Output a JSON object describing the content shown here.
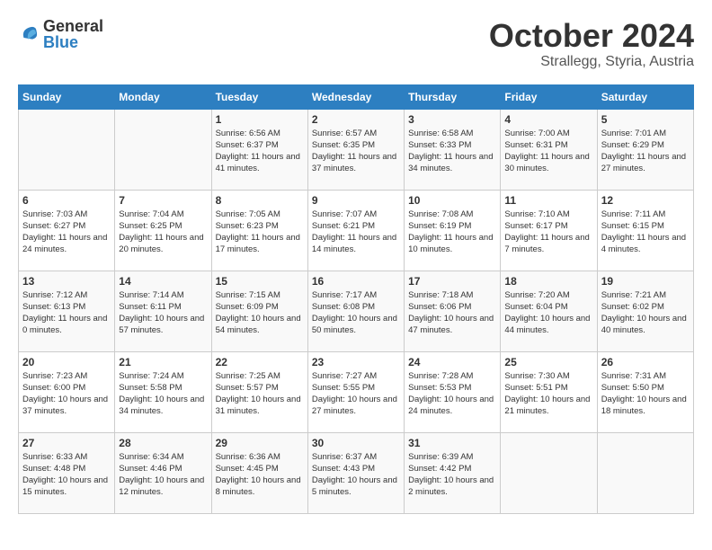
{
  "logo": {
    "line1": "General",
    "line2": "Blue"
  },
  "title": "October 2024",
  "subtitle": "Strallegg, Styria, Austria",
  "weekdays": [
    "Sunday",
    "Monday",
    "Tuesday",
    "Wednesday",
    "Thursday",
    "Friday",
    "Saturday"
  ],
  "weeks": [
    [
      {
        "day": "",
        "info": ""
      },
      {
        "day": "",
        "info": ""
      },
      {
        "day": "1",
        "info": "Sunrise: 6:56 AM\nSunset: 6:37 PM\nDaylight: 11 hours and 41 minutes."
      },
      {
        "day": "2",
        "info": "Sunrise: 6:57 AM\nSunset: 6:35 PM\nDaylight: 11 hours and 37 minutes."
      },
      {
        "day": "3",
        "info": "Sunrise: 6:58 AM\nSunset: 6:33 PM\nDaylight: 11 hours and 34 minutes."
      },
      {
        "day": "4",
        "info": "Sunrise: 7:00 AM\nSunset: 6:31 PM\nDaylight: 11 hours and 30 minutes."
      },
      {
        "day": "5",
        "info": "Sunrise: 7:01 AM\nSunset: 6:29 PM\nDaylight: 11 hours and 27 minutes."
      }
    ],
    [
      {
        "day": "6",
        "info": "Sunrise: 7:03 AM\nSunset: 6:27 PM\nDaylight: 11 hours and 24 minutes."
      },
      {
        "day": "7",
        "info": "Sunrise: 7:04 AM\nSunset: 6:25 PM\nDaylight: 11 hours and 20 minutes."
      },
      {
        "day": "8",
        "info": "Sunrise: 7:05 AM\nSunset: 6:23 PM\nDaylight: 11 hours and 17 minutes."
      },
      {
        "day": "9",
        "info": "Sunrise: 7:07 AM\nSunset: 6:21 PM\nDaylight: 11 hours and 14 minutes."
      },
      {
        "day": "10",
        "info": "Sunrise: 7:08 AM\nSunset: 6:19 PM\nDaylight: 11 hours and 10 minutes."
      },
      {
        "day": "11",
        "info": "Sunrise: 7:10 AM\nSunset: 6:17 PM\nDaylight: 11 hours and 7 minutes."
      },
      {
        "day": "12",
        "info": "Sunrise: 7:11 AM\nSunset: 6:15 PM\nDaylight: 11 hours and 4 minutes."
      }
    ],
    [
      {
        "day": "13",
        "info": "Sunrise: 7:12 AM\nSunset: 6:13 PM\nDaylight: 11 hours and 0 minutes."
      },
      {
        "day": "14",
        "info": "Sunrise: 7:14 AM\nSunset: 6:11 PM\nDaylight: 10 hours and 57 minutes."
      },
      {
        "day": "15",
        "info": "Sunrise: 7:15 AM\nSunset: 6:09 PM\nDaylight: 10 hours and 54 minutes."
      },
      {
        "day": "16",
        "info": "Sunrise: 7:17 AM\nSunset: 6:08 PM\nDaylight: 10 hours and 50 minutes."
      },
      {
        "day": "17",
        "info": "Sunrise: 7:18 AM\nSunset: 6:06 PM\nDaylight: 10 hours and 47 minutes."
      },
      {
        "day": "18",
        "info": "Sunrise: 7:20 AM\nSunset: 6:04 PM\nDaylight: 10 hours and 44 minutes."
      },
      {
        "day": "19",
        "info": "Sunrise: 7:21 AM\nSunset: 6:02 PM\nDaylight: 10 hours and 40 minutes."
      }
    ],
    [
      {
        "day": "20",
        "info": "Sunrise: 7:23 AM\nSunset: 6:00 PM\nDaylight: 10 hours and 37 minutes."
      },
      {
        "day": "21",
        "info": "Sunrise: 7:24 AM\nSunset: 5:58 PM\nDaylight: 10 hours and 34 minutes."
      },
      {
        "day": "22",
        "info": "Sunrise: 7:25 AM\nSunset: 5:57 PM\nDaylight: 10 hours and 31 minutes."
      },
      {
        "day": "23",
        "info": "Sunrise: 7:27 AM\nSunset: 5:55 PM\nDaylight: 10 hours and 27 minutes."
      },
      {
        "day": "24",
        "info": "Sunrise: 7:28 AM\nSunset: 5:53 PM\nDaylight: 10 hours and 24 minutes."
      },
      {
        "day": "25",
        "info": "Sunrise: 7:30 AM\nSunset: 5:51 PM\nDaylight: 10 hours and 21 minutes."
      },
      {
        "day": "26",
        "info": "Sunrise: 7:31 AM\nSunset: 5:50 PM\nDaylight: 10 hours and 18 minutes."
      }
    ],
    [
      {
        "day": "27",
        "info": "Sunrise: 6:33 AM\nSunset: 4:48 PM\nDaylight: 10 hours and 15 minutes."
      },
      {
        "day": "28",
        "info": "Sunrise: 6:34 AM\nSunset: 4:46 PM\nDaylight: 10 hours and 12 minutes."
      },
      {
        "day": "29",
        "info": "Sunrise: 6:36 AM\nSunset: 4:45 PM\nDaylight: 10 hours and 8 minutes."
      },
      {
        "day": "30",
        "info": "Sunrise: 6:37 AM\nSunset: 4:43 PM\nDaylight: 10 hours and 5 minutes."
      },
      {
        "day": "31",
        "info": "Sunrise: 6:39 AM\nSunset: 4:42 PM\nDaylight: 10 hours and 2 minutes."
      },
      {
        "day": "",
        "info": ""
      },
      {
        "day": "",
        "info": ""
      }
    ]
  ]
}
